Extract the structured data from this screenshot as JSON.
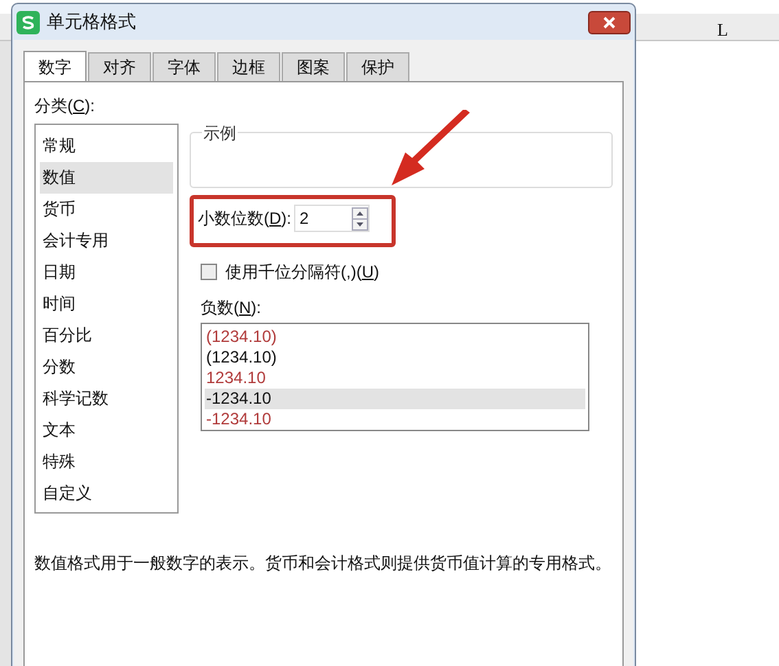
{
  "spreadsheet": {
    "column_header": "L"
  },
  "dialog": {
    "title": "单元格格式",
    "tabs": [
      {
        "label": "数字",
        "selected": true
      },
      {
        "label": "对齐",
        "selected": false
      },
      {
        "label": "字体",
        "selected": false
      },
      {
        "label": "边框",
        "selected": false
      },
      {
        "label": "图案",
        "selected": false
      },
      {
        "label": "保护",
        "selected": false
      }
    ],
    "category_label": {
      "before": "分类(",
      "accelerator": "C",
      "after": "):"
    },
    "categories": [
      {
        "label": "常规",
        "selected": false
      },
      {
        "label": "数值",
        "selected": true
      },
      {
        "label": "货币",
        "selected": false
      },
      {
        "label": "会计专用",
        "selected": false
      },
      {
        "label": "日期",
        "selected": false
      },
      {
        "label": "时间",
        "selected": false
      },
      {
        "label": "百分比",
        "selected": false
      },
      {
        "label": "分数",
        "selected": false
      },
      {
        "label": "科学记数",
        "selected": false
      },
      {
        "label": "文本",
        "selected": false
      },
      {
        "label": "特殊",
        "selected": false
      },
      {
        "label": "自定义",
        "selected": false
      }
    ],
    "sample_group": {
      "title": "示例"
    },
    "decimal_places": {
      "label": {
        "before": "小数位数(",
        "accelerator": "D",
        "after": "):"
      },
      "value": "2"
    },
    "thousands_separator": {
      "label": {
        "before": "使用千位分隔符(,)(",
        "accelerator": "U",
        "after": ")"
      },
      "checked": false
    },
    "negative_label": {
      "before": "负数(",
      "accelerator": "N",
      "after": "):"
    },
    "negative_formats": [
      {
        "label": "(1234.10)",
        "color": "#b03a3a",
        "selected": false
      },
      {
        "label": "(1234.10)",
        "color": "#111111",
        "selected": false
      },
      {
        "label": "1234.10",
        "color": "#b03a3a",
        "selected": false
      },
      {
        "label": "-1234.10",
        "color": "#111111",
        "selected": true
      },
      {
        "label": "-1234.10",
        "color": "#b03a3a",
        "selected": false
      }
    ],
    "description": "数值格式用于一般数字的表示。货币和会计格式则提供货币值计算的专用格式。"
  }
}
